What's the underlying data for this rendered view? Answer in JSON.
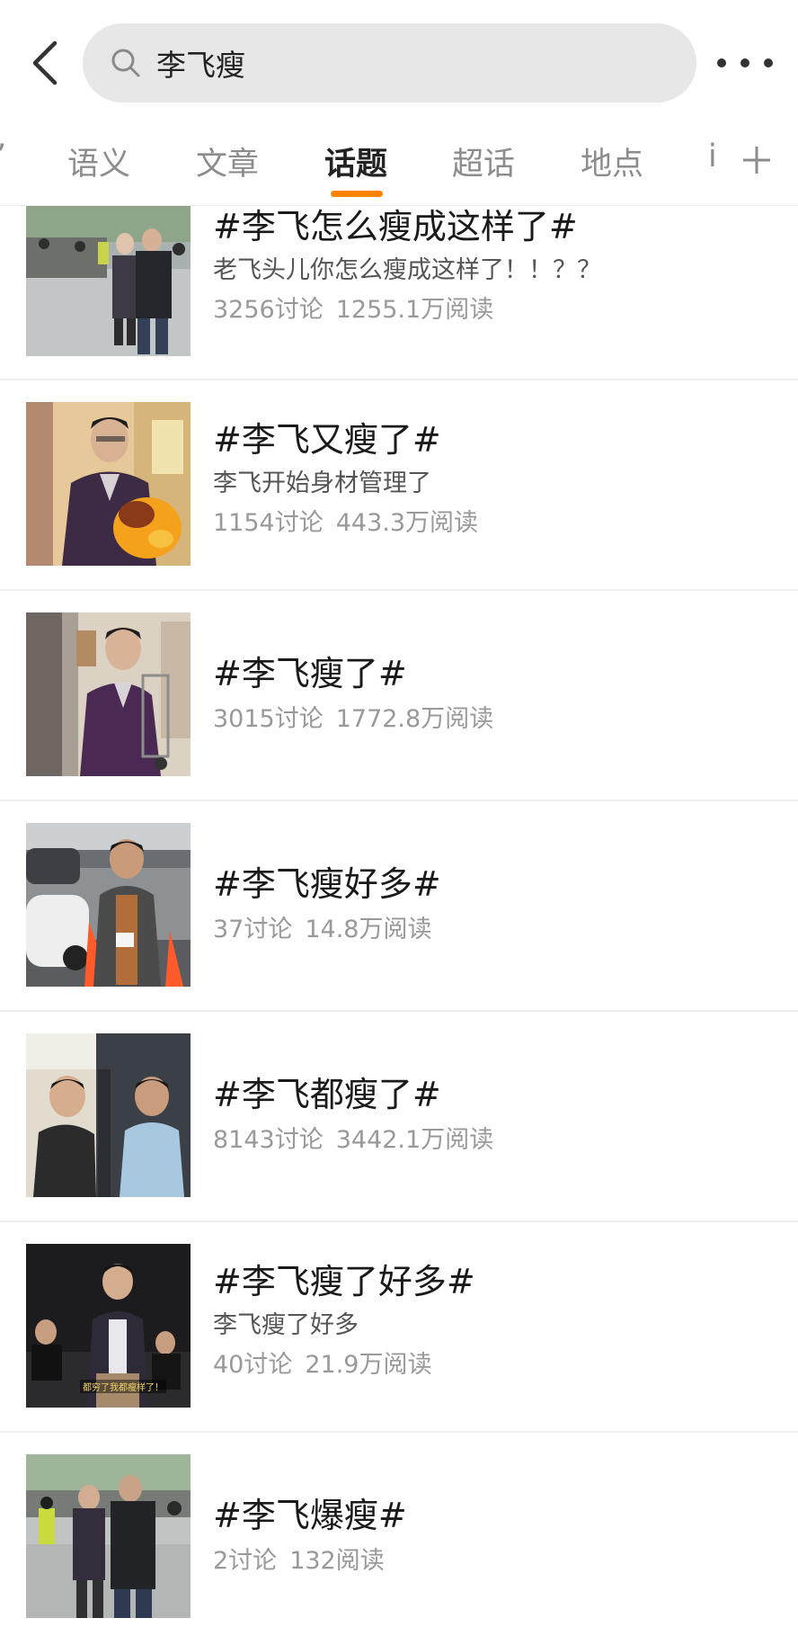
{
  "search": {
    "query": "李飞瘦"
  },
  "tabs": {
    "partial_left": "’",
    "items": [
      {
        "label": "语义",
        "active": false
      },
      {
        "label": "文章",
        "active": false
      },
      {
        "label": "话题",
        "active": true
      },
      {
        "label": "超话",
        "active": false
      },
      {
        "label": "地点",
        "active": false
      }
    ],
    "partial_right": "i"
  },
  "accent_color": "#ff8200",
  "topics": [
    {
      "title": "#李飞怎么瘦成这样了#",
      "desc": "老飞头儿你怎么瘦成这样了！！？？",
      "discussions": "3256讨论",
      "reads": "1255.1万阅读"
    },
    {
      "title": "#李飞又瘦了#",
      "desc": "李飞开始身材管理了",
      "discussions": "1154讨论",
      "reads": "443.3万阅读"
    },
    {
      "title": "#李飞瘦了#",
      "desc": "",
      "discussions": "3015讨论",
      "reads": "1772.8万阅读"
    },
    {
      "title": "#李飞瘦好多#",
      "desc": "",
      "discussions": "37讨论",
      "reads": "14.8万阅读"
    },
    {
      "title": "#李飞都瘦了#",
      "desc": "",
      "discussions": "8143讨论",
      "reads": "3442.1万阅读"
    },
    {
      "title": "#李飞瘦了好多#",
      "desc": "李飞瘦了好多",
      "discussions": "40讨论",
      "reads": "21.9万阅读"
    },
    {
      "title": "#李飞爆瘦#",
      "desc": "",
      "discussions": "2讨论",
      "reads": "132阅读"
    }
  ],
  "thumb_caption": "都穷了我都瘦样了！"
}
